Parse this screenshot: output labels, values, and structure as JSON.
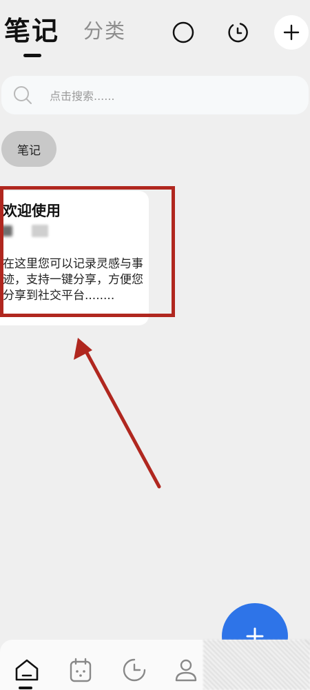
{
  "header": {
    "tab_active": "笔记",
    "tab_inactive": "分类",
    "icons": [
      "circle-icon",
      "clock-icon",
      "plus-icon"
    ]
  },
  "search": {
    "placeholder": "点击搜索......"
  },
  "filter_chip": {
    "label": "笔记"
  },
  "note_card": {
    "title": "欢迎使用",
    "body": "在这里您可以记录灵感与事迹，支持一键分享，方便您分享到社交平台........"
  },
  "colors": {
    "accent_blue": "#2e74e8",
    "annotation_red": "#b0271f",
    "background": "#efefef"
  },
  "bottom_nav": {
    "items": [
      "home-icon",
      "calendar-icon",
      "pie-chart-icon",
      "profile-icon"
    ]
  },
  "fab": {
    "icon": "plus-icon"
  }
}
